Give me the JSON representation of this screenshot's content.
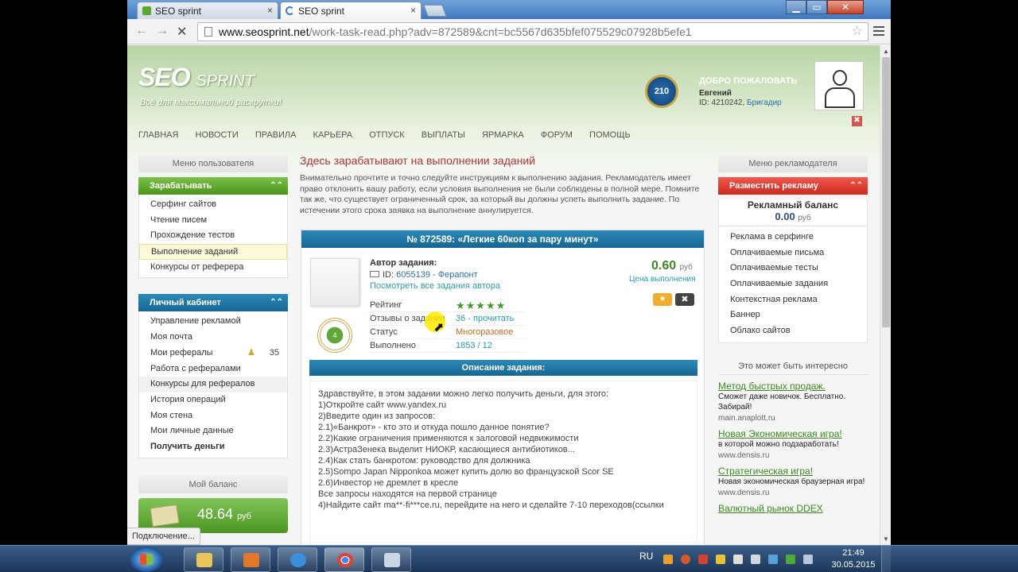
{
  "browser": {
    "tabs": [
      {
        "label": "SEO sprint",
        "close": "×"
      },
      {
        "label": "SEO sprint",
        "close": "×"
      }
    ],
    "url_host": "www.seosprint.net",
    "url_path": "/work-task-read.php?adv=872589&cnt=bc5567d635bfef075529c07928b5efe1",
    "status": "Подключение...",
    "window_controls": {
      "min": "▁",
      "max": "▭",
      "close": "✕"
    }
  },
  "site": {
    "logo_main": "SEO",
    "logo_sub": "SPRINT",
    "tagline": "Всё для максимальной раскрутки!",
    "level": "210",
    "welcome": "ДОБРО ПОЖАЛОВАТЬ",
    "user_name": "Евгений",
    "user_id": "ID: 4210242,",
    "user_rank": "Бригадир",
    "nav": [
      "Главная",
      "Новости",
      "Правила",
      "Карьера",
      "Отпуск",
      "Выплаты",
      "Ярмарка",
      "Форум",
      "Помощь"
    ]
  },
  "left": {
    "menu_title": "Меню пользователя",
    "earn": {
      "title": "Зарабатывать",
      "items": [
        "Серфинг сайтов",
        "Чтение писем",
        "Прохождение тестов",
        "Выполнение заданий",
        "Конкурсы от реферера"
      ]
    },
    "cabinet": {
      "title": "Личный кабинет",
      "items": [
        "Управление рекламой",
        "Моя почта",
        "Мои рефералы",
        "Работа с рефералами",
        "Конкурсы для рефералов",
        "История операций",
        "Моя стена",
        "Мои личные данные",
        "Получить деньги"
      ],
      "referral_count": "35"
    },
    "balance_title": "Мой баланс",
    "balance": "48.64",
    "balance_unit": "руб"
  },
  "main": {
    "title": "Здесь зарабатывают на выполнении заданий",
    "intro": "Внимательно прочтите и точно следуйте инструкциям к выполнению задания. Рекламодатель имеет право отклонить вашу работу, если условия выполнения не были соблюдены в полной мере. Помните так же, что существует ограниченный срок, за который вы должны успеть выполнить задание. По истечении этого срока заявка на выполнение аннулируется.",
    "task": {
      "header": "№ 872589: «Легкие 60коп за пару минут»",
      "author_label": "Автор задания:",
      "author_id": "ID:",
      "author_link": "6055139 - Ферапонт",
      "see_all": "Посмотреть все задания автора",
      "price": "0.60",
      "price_unit": "руб",
      "price_label": "Цена выполнения",
      "badge_level": "4",
      "rating_label": "Рейтинг",
      "rating_stars": 5,
      "reviews_label": "Отзывы о задании",
      "reviews_value": "36 - прочитать",
      "status_label": "Статус",
      "status_value": "Многоразовое",
      "done_label": "Выполнено",
      "done_value": "1853 / 12",
      "desc_header": "Описание задания:",
      "desc_lines": [
        "Здравствуйте, в этом задании можно легко получить деньги, для этого:",
        "1)Откройте сайт www.yandex.ru",
        "2)Введите один из запросов:",
        "2.1)«Банкрот» - кто это и откуда пошло данное понятие?",
        "2.2)Какие ограничения применяются к залоговой недвижимости",
        "2.3)АстраЗенека выделит НИОКР, касающиеся антибиотиков...",
        "2.4)Как стать банкротом: руководство для должника",
        "2.5)Sompo Japan Nipponkoa может купить долю во французской Scor SE",
        "2.6)Инвестор не дремлет в кресле",
        "Все запросы находятся на первой странице",
        "4)Найдите сайт ma**-fi***ce.ru, перейдите на него и сделайте 7-10 переходов(ссылки"
      ]
    }
  },
  "right": {
    "menu_title": "Меню рекламодателя",
    "place_ad": "Разместить рекламу",
    "balance_title": "Рекламный баланс",
    "balance": "0.00",
    "balance_unit": "руб",
    "items": [
      "Реклама в серфинге",
      "Оплачиваемые письма",
      "Оплачиваемые тесты",
      "Оплачиваемые задания",
      "Контекстная реклама",
      "Баннер",
      "Облако сайтов"
    ],
    "interest_title": "Это может быть интересно",
    "ads": [
      {
        "title": "Метод быстрых продаж.",
        "desc": "Сможет даже новичок. Бесплатно. Забирай!",
        "url": "main.anaplott.ru"
      },
      {
        "title": "Новая Экономическая игра!",
        "desc": "в которой можно подзаработать!",
        "url": "www.densis.ru"
      },
      {
        "title": "Стратегическая игра!",
        "desc": "Новая экономическая браузерная игра!",
        "url": "www.densis.ru"
      },
      {
        "title": "Валютный рынок DDEX",
        "desc": "",
        "url": ""
      }
    ]
  },
  "taskbar": {
    "lang": "RU",
    "time": "21:49",
    "date": "30.05.2015"
  }
}
